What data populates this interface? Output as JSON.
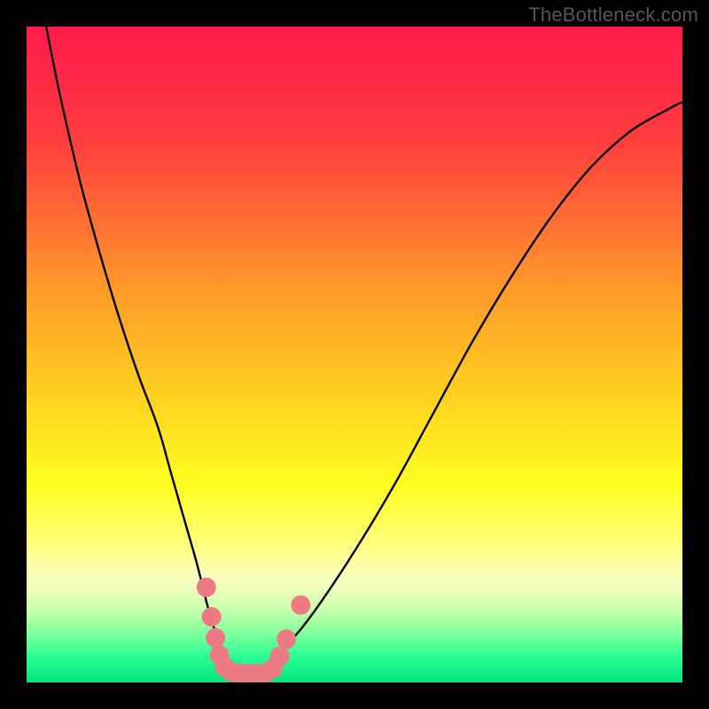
{
  "watermark": "TheBottleneck.com",
  "chart_data": {
    "type": "line",
    "title": "",
    "xlabel": "",
    "ylabel": "",
    "xlim": [
      0,
      100
    ],
    "ylim": [
      0,
      100
    ],
    "gradient_stops": [
      {
        "offset": 0,
        "color": "#ff1a4b"
      },
      {
        "offset": 18,
        "color": "#ff3f3e"
      },
      {
        "offset": 40,
        "color": "#ff9a2a"
      },
      {
        "offset": 58,
        "color": "#ffd61f"
      },
      {
        "offset": 70,
        "color": "#ffff22"
      },
      {
        "offset": 78,
        "color": "#feff70"
      },
      {
        "offset": 84,
        "color": "#fbffc0"
      },
      {
        "offset": 88,
        "color": "#d6ffb0"
      },
      {
        "offset": 92,
        "color": "#8bff9e"
      },
      {
        "offset": 96,
        "color": "#2dff93"
      },
      {
        "offset": 100,
        "color": "#00e47e"
      }
    ],
    "series": [
      {
        "name": "bottleneck-curve",
        "x": [
          3,
          5,
          8,
          11,
          14,
          17,
          20,
          22,
          24,
          26,
          27.5,
          29,
          30.5,
          32,
          33.5,
          35,
          37,
          40,
          44,
          50,
          56,
          62,
          68,
          74,
          80,
          86,
          92,
          98,
          100
        ],
        "values": [
          100,
          90,
          77,
          66,
          56,
          47,
          39,
          32,
          25,
          18,
          12,
          7,
          3.5,
          1.8,
          1.2,
          1.6,
          3,
          6,
          11,
          20,
          30,
          41,
          52,
          62,
          71,
          78.5,
          84,
          87.5,
          88.5
        ]
      }
    ],
    "markers": {
      "name": "highlighted-points",
      "color": "#ed7b84",
      "points": [
        {
          "x": 27.4,
          "y": 14.5
        },
        {
          "x": 28.2,
          "y": 10.0
        },
        {
          "x": 28.8,
          "y": 6.8
        },
        {
          "x": 29.4,
          "y": 4.2
        },
        {
          "x": 30.2,
          "y": 2.4
        },
        {
          "x": 31.2,
          "y": 1.6
        },
        {
          "x": 32.4,
          "y": 1.4
        },
        {
          "x": 33.6,
          "y": 1.4
        },
        {
          "x": 35.0,
          "y": 1.4
        },
        {
          "x": 36.4,
          "y": 1.4
        },
        {
          "x": 37.6,
          "y": 2.2
        },
        {
          "x": 38.6,
          "y": 4.0
        },
        {
          "x": 39.6,
          "y": 6.6
        },
        {
          "x": 41.8,
          "y": 11.8
        }
      ]
    }
  }
}
